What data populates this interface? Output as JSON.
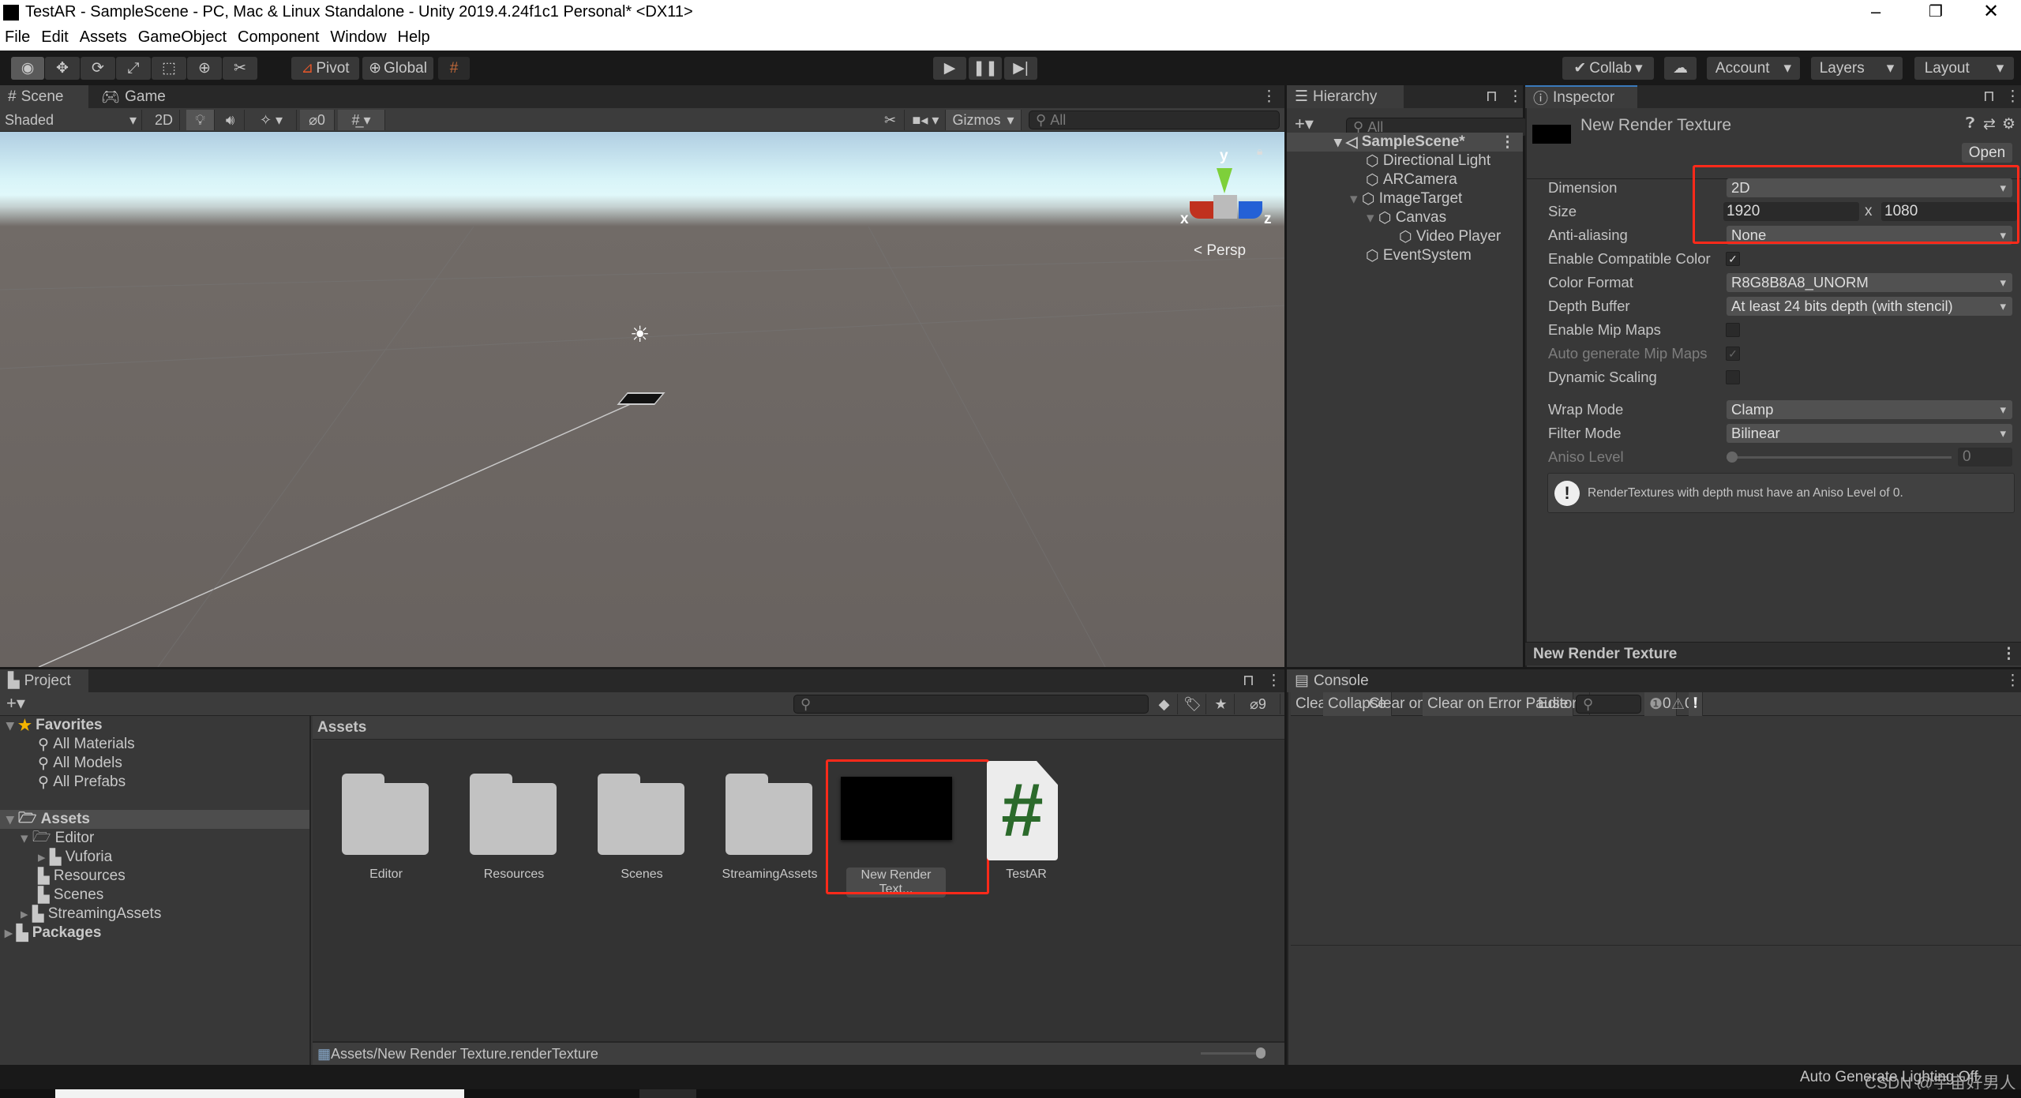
{
  "window": {
    "title": "TestAR - SampleScene - PC, Mac & Linux Standalone - Unity 2019.4.24f1c1 Personal* <DX11>"
  },
  "menu": [
    "File",
    "Edit",
    "Assets",
    "GameObject",
    "Component",
    "Window",
    "Help"
  ],
  "toolbar": {
    "pivot": "Pivot",
    "global": "Global",
    "collab": "Collab",
    "account": "Account",
    "layers": "Layers",
    "layout": "Layout"
  },
  "scene": {
    "tab_scene": "Scene",
    "tab_game": "Game",
    "shading": "Shaded",
    "mode_2d": "2D",
    "hidden_count": "0",
    "gizmos": "Gizmos",
    "search_placeholder": "All",
    "persp": "Persp",
    "axis_x": "x",
    "axis_y": "y",
    "axis_z": "z"
  },
  "hierarchy": {
    "tab": "Hierarchy",
    "search_placeholder": "All",
    "scene": "SampleScene*",
    "items": [
      {
        "label": "Directional Light",
        "depth": 0
      },
      {
        "label": "ARCamera",
        "depth": 0
      },
      {
        "label": "ImageTarget",
        "depth": 0,
        "expanded": true
      },
      {
        "label": "Canvas",
        "depth": 1,
        "expanded": true
      },
      {
        "label": "Video Player",
        "depth": 2
      },
      {
        "label": "EventSystem",
        "depth": 0
      }
    ]
  },
  "inspector": {
    "tab": "Inspector",
    "title": "New Render Texture",
    "open": "Open",
    "dimension_label": "Dimension",
    "dimension": "2D",
    "size_label": "Size",
    "width": "1920",
    "x": "x",
    "height": "1080",
    "aa_label": "Anti-aliasing",
    "aa": "None",
    "compat_label": "Enable Compatible Color",
    "compat": true,
    "format_label": "Color Format",
    "format": "R8G8B8A8_UNORM",
    "depth_label": "Depth Buffer",
    "depth": "At least 24 bits depth (with stencil)",
    "mip_label": "Enable Mip Maps",
    "mip": false,
    "automip_label": "Auto generate Mip Maps",
    "automip": true,
    "dyn_label": "Dynamic Scaling",
    "dyn": false,
    "wrap_label": "Wrap Mode",
    "wrap": "Clamp",
    "filter_label": "Filter Mode",
    "filter": "Bilinear",
    "aniso_label": "Aniso Level",
    "aniso": "0",
    "warning": "RenderTextures with depth must have an Aniso Level of 0.",
    "preview_title": "New Render Texture"
  },
  "project": {
    "tab": "Project",
    "hidden_count": "9",
    "favorites": "Favorites",
    "fav_items": [
      "All Materials",
      "All Models",
      "All Prefabs"
    ],
    "tree": {
      "assets": "Assets",
      "editor": "Editor",
      "vuforia": "Vuforia",
      "resources": "Resources",
      "scenes": "Scenes",
      "streaming": "StreamingAssets",
      "packages": "Packages"
    },
    "breadcrumb": "Assets",
    "assets": [
      {
        "label": "Editor",
        "type": "folder"
      },
      {
        "label": "Resources",
        "type": "folder"
      },
      {
        "label": "Scenes",
        "type": "folder"
      },
      {
        "label": "StreamingAssets",
        "type": "folder"
      },
      {
        "label": "New Render Text...",
        "type": "render-texture",
        "selected": true
      },
      {
        "label": "TestAR",
        "type": "script"
      }
    ],
    "path": "Assets/New Render Texture.renderTexture"
  },
  "console": {
    "tab": "Console",
    "clear": "Clear",
    "collapse": "Collapse",
    "clear_on_play": "Clear on Play",
    "clear_on_build": "Clear on Build",
    "error_pause": "Error Pause",
    "editor": "Editor",
    "log_count": "0",
    "warn_count": "0"
  },
  "status": {
    "lighting": "Auto Generate Lighting Off",
    "watermark": "CSDN @宇宙好男人"
  },
  "colors": {
    "highlight": "#ff2a1a",
    "accent": "#3a79bb"
  }
}
